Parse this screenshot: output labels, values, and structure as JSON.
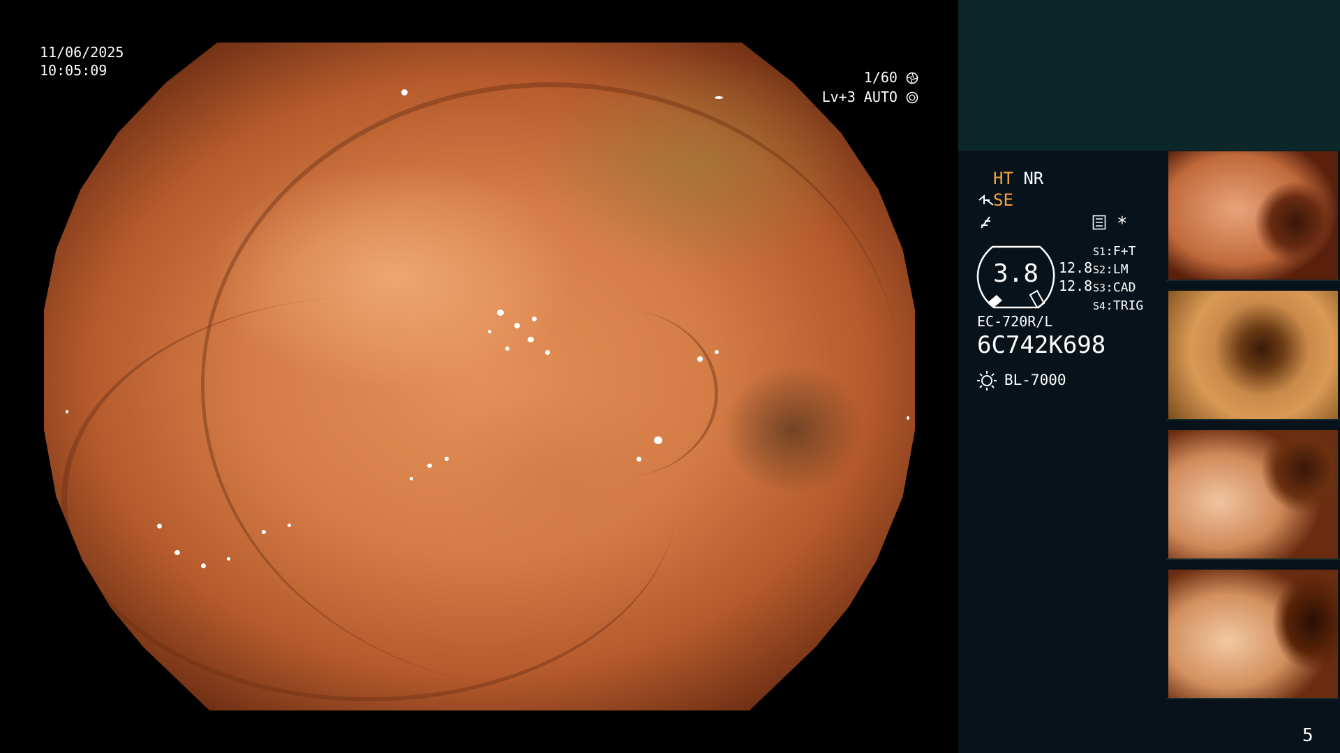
{
  "overlay": {
    "date": "11/06/2025",
    "time": "10:05:09",
    "shutter": "1/60",
    "level": "Lv+3 AUTO"
  },
  "panel": {
    "ht_label": "HT",
    "nr_label": "NR",
    "se_label": "SE",
    "asterisk": "*",
    "gauge_value": "3.8",
    "gauge_right_1": "12.8",
    "gauge_right_2": "12.8",
    "switches": [
      {
        "key": "S1",
        "value": "F+T"
      },
      {
        "key": "S2",
        "value": "LM"
      },
      {
        "key": "S3",
        "value": "CAD"
      },
      {
        "key": "S4",
        "value": "TRIG"
      }
    ],
    "scope_model": "EC-720R/L",
    "scope_serial": "6C742K698",
    "light_source": "BL-7000"
  },
  "page_number": "5",
  "colors": {
    "accent_orange": "#f7a33a",
    "panel_bg": "#07121a",
    "panel_top_bg": "#0b2729"
  },
  "icons": [
    "shutter-icon",
    "iris-icon",
    "pump-icon",
    "freeze-icon",
    "memo-icon",
    "light-icon"
  ]
}
